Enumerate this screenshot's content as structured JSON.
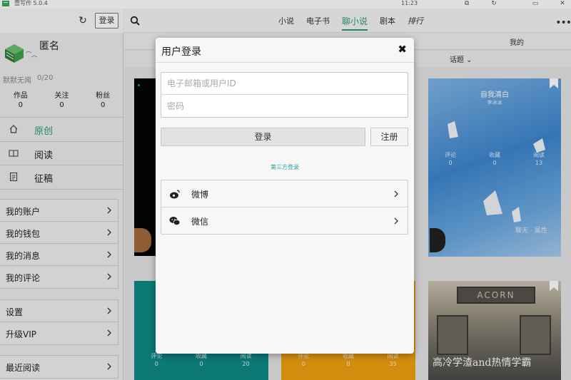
{
  "titlebar": {
    "app_name": "壹写作 5.0.4",
    "clock": "11:23"
  },
  "sidebar": {
    "login_button": "登录",
    "username": "匿名",
    "bio": "默默无闻",
    "bio_count": "0/20",
    "stats": [
      {
        "label": "作品",
        "value": "0"
      },
      {
        "label": "关注",
        "value": "0"
      },
      {
        "label": "粉丝",
        "value": "0"
      }
    ],
    "nav": [
      {
        "label": "原创",
        "icon": "home-icon",
        "active": true
      },
      {
        "label": "阅读",
        "icon": "book-icon",
        "active": false
      },
      {
        "label": "征稿",
        "icon": "document-icon",
        "active": false
      }
    ],
    "menu1": [
      "我的账户",
      "我的钱包",
      "我的消息",
      "我的评论"
    ],
    "menu2": [
      "设置",
      "升级VIP"
    ],
    "menu3": [
      "最近阅读"
    ]
  },
  "main": {
    "tabs": [
      {
        "label": "小说",
        "active": false
      },
      {
        "label": "电子书",
        "active": false
      },
      {
        "label": "聊小说",
        "active": true
      },
      {
        "label": "剧本",
        "active": false
      },
      {
        "label": "排行",
        "active": false
      }
    ],
    "more": "•••",
    "mine": "我的",
    "topic": "话题 ⌄",
    "cards": {
      "sky_title": "自我清白",
      "sky_author": "李冰冰",
      "sky_stats": [
        {
          "label": "评论",
          "value": "0"
        },
        {
          "label": "收藏",
          "value": "0"
        },
        {
          "label": "阅读",
          "value": "13"
        }
      ],
      "sky_caption": "聊天 · 属性",
      "teal_stats": [
        {
          "label": "评论",
          "value": "0"
        },
        {
          "label": "收藏",
          "value": "0"
        },
        {
          "label": "阅读",
          "value": "20"
        }
      ],
      "orange_stats": [
        {
          "label": "评论",
          "value": "0"
        },
        {
          "label": "收藏",
          "value": "0"
        },
        {
          "label": "阅读",
          "value": "35"
        }
      ],
      "train_sign": "ACORN",
      "train_title": "高冷学渣and热情学霸"
    }
  },
  "modal": {
    "title": "用户登录",
    "close": "✖",
    "email_placeholder": "电子邮箱或用户ID",
    "password_placeholder": "密码",
    "login_button": "登录",
    "register_button": "注册",
    "third_party_label": "第三方登录",
    "social": [
      {
        "label": "微博",
        "icon": "weibo-icon"
      },
      {
        "label": "微信",
        "icon": "wechat-icon"
      }
    ]
  }
}
